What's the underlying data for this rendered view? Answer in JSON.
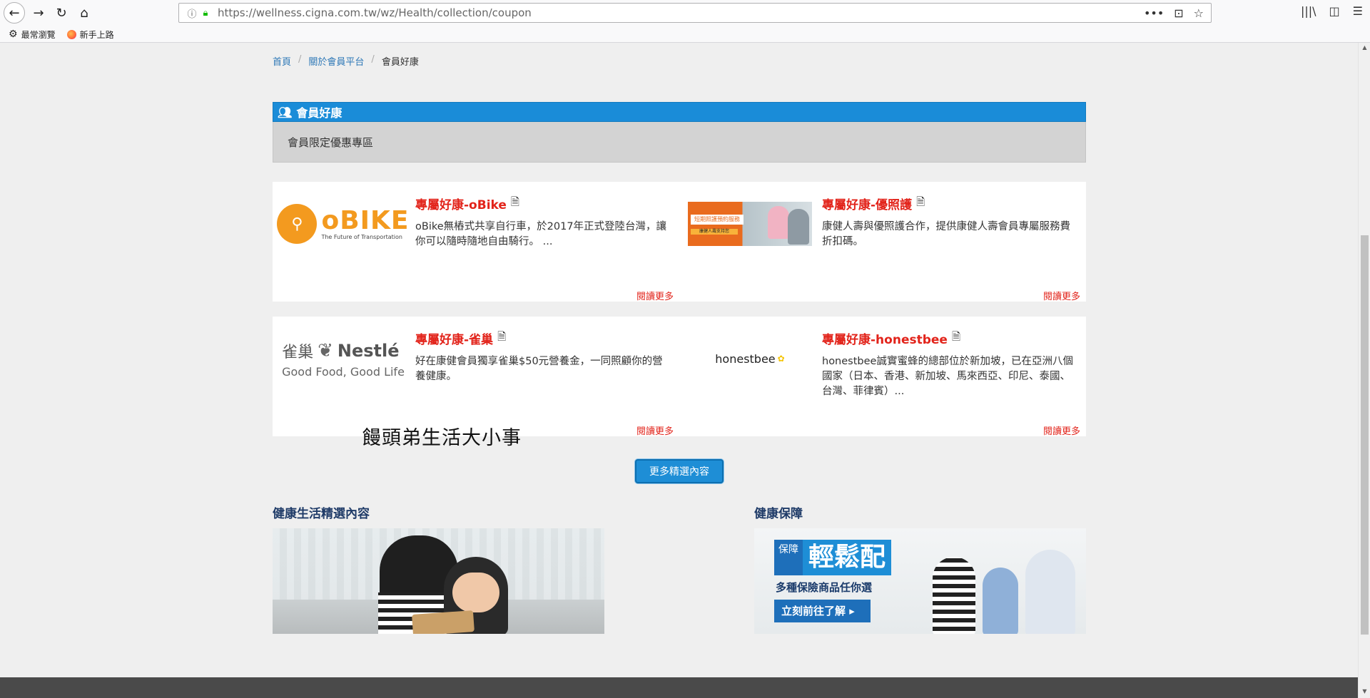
{
  "browser": {
    "url": "https://wellness.cigna.com.tw/wz/Health/collection/coupon",
    "url_actions": [
      "•••",
      "⊡",
      "☆"
    ],
    "toolbar_right": [
      "|||\\",
      "◫",
      "☰"
    ],
    "bookmarks": [
      {
        "label": "最常瀏覽",
        "icon": "gear-icon"
      },
      {
        "label": "新手上路",
        "icon": "firefox-icon"
      }
    ]
  },
  "breadcrumb": {
    "home": "首頁",
    "about": "關於會員平台",
    "current": "會員好康",
    "separator": "/"
  },
  "section": {
    "title": "會員好康",
    "subtitle": "會員限定優惠專區"
  },
  "coupons": [
    {
      "title": "專屬好康-oBike",
      "desc": "oBike無樁式共享自行車，於2017年正式登陸台灣，讓你可以隨時隨地自由騎行。 ...",
      "read_more": "閱讀更多",
      "logo_word": "oBIKE",
      "logo_tag": "The Future of Transportation"
    },
    {
      "title": "專屬好康-優照護",
      "desc": "康健人壽與優照護合作，提供康健人壽會員專屬服務費折扣碼。",
      "read_more": "閱讀更多",
      "logo_banner": "短期照護預約服務",
      "logo_strip": "康健人壽支持您"
    },
    {
      "title": "專屬好康-雀巢",
      "desc": "好在康健會員獨享雀巢$50元營養金，一同照顧你的營養健康。",
      "read_more": "閱讀更多",
      "logo_cn": "雀巢",
      "logo_word": "Nestlé",
      "logo_tag": "Good Food, Good Life"
    },
    {
      "title": "專屬好康-honestbee",
      "desc": "honestbee誠實蜜蜂的總部位於新加坡，已在亞洲八個國家（日本、香港、新加坡、馬來西亞、印尼、泰國、台灣、菲律賓）...",
      "read_more": "閱讀更多",
      "logo_word": "honestbee"
    }
  ],
  "watermark": "饅頭弟生活大小事",
  "more_button": "更多精選內容",
  "featured": {
    "left_title": "健康生活精選內容",
    "right_title": "健康保障"
  },
  "insurance_banner": {
    "badge": "保障",
    "title": "輕鬆配",
    "subtitle": "多種保險商品任你選",
    "cta": "立刻前往了解 ▸"
  },
  "colors": {
    "accent": "#1a8cd8",
    "coupon_title": "#e2231a",
    "link": "#2e78b7",
    "heading": "#1f3b68"
  }
}
